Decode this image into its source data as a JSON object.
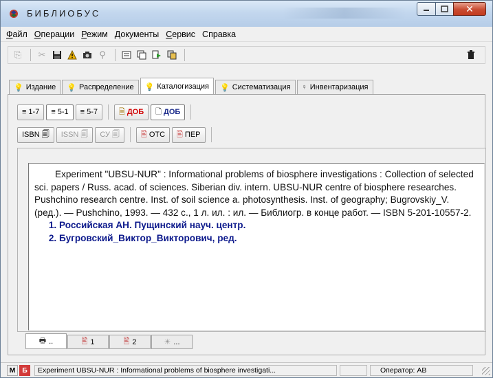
{
  "window": {
    "title": "БИБЛИОБУС"
  },
  "menu": [
    {
      "acc": "Ф",
      "rest": "айл"
    },
    {
      "acc": "О",
      "rest": "перации"
    },
    {
      "acc": "Р",
      "rest": "ежим"
    },
    {
      "acc": "Д",
      "rest": "окументы"
    },
    {
      "acc": "С",
      "rest": "ервис"
    },
    {
      "acc": "",
      "rest": "Справка"
    }
  ],
  "tabs": [
    "Издание",
    "Распределение",
    "Каталогизация",
    "Систематизация",
    "Инвентаризация"
  ],
  "active_tab": "Каталогизация",
  "inner_toolbar": {
    "range_1_7": "1-7",
    "range_5_1": "5-1",
    "range_5_7": "5-7",
    "dob_red": "ДОБ",
    "dob_blue": "ДОБ",
    "isbn": "ISBN",
    "issn": "ISSN",
    "su": "СУ",
    "ots": "ОТС",
    "per": "ПЕР"
  },
  "record": {
    "text": "Experiment \"UBSU-NUR\" : Informational problems of biosphere investigations : Collection of selected sci. papers / Russ. acad. of sciences. Siberian div. intern. UBSU-NUR centre of biosphere researches. Pushchino research centre. Inst. of soil science a. photosynthesis. Inst. of geography; Bugrovskiy_V. (ред.). — Pushchino, 1993. — 432 с., 1 л. ил. : ил. — Библиогр. в конце работ. — ISBN 5-201-10557-2.",
    "entries": [
      "Российская АН. Пущинский науч. центр.",
      "Бугровский_Виктор_Викторович, ред."
    ]
  },
  "bottom_tabs": [
    "..",
    "1",
    "2",
    "..."
  ],
  "status": {
    "m": "М",
    "b": "Б",
    "text": "Experiment UBSU-NUR : Informational problems of biosphere investigati...",
    "operator": "Оператор: АВ"
  }
}
